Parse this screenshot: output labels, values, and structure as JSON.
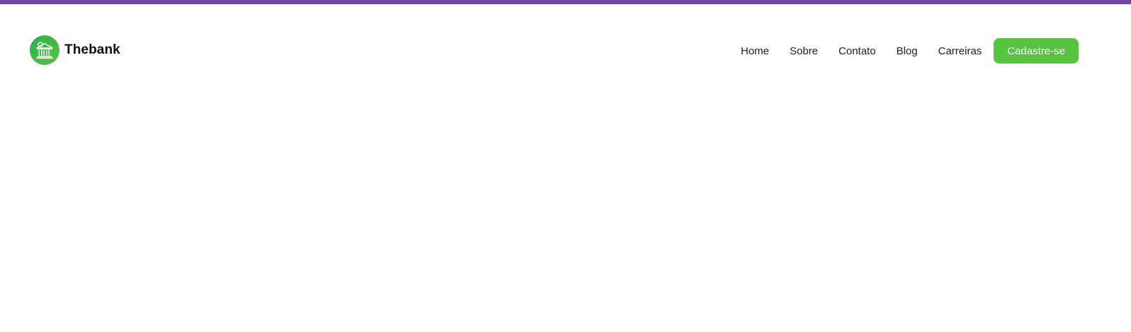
{
  "colors": {
    "top_bar": "#6f45a6",
    "brand_green": "#58c341",
    "text": "#1e1e1e"
  },
  "brand": {
    "name": "Thebank",
    "logo_icon": "bank-building-icon"
  },
  "nav": {
    "items": [
      {
        "label": "Home"
      },
      {
        "label": "Sobre"
      },
      {
        "label": "Contato"
      },
      {
        "label": "Blog"
      },
      {
        "label": "Carreiras"
      }
    ],
    "cta_label": "Cadastre-se"
  }
}
